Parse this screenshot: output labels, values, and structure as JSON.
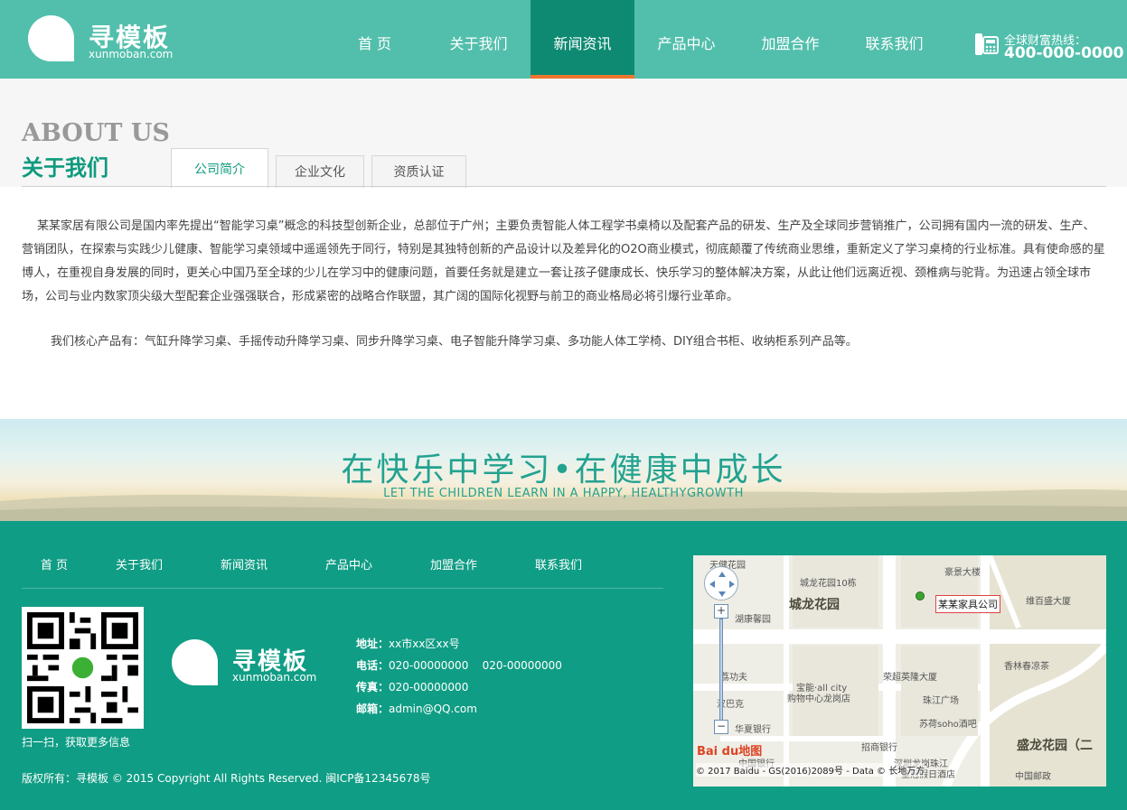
{
  "header": {
    "logo_cn": "寻模板",
    "logo_en": "xunmoban.com",
    "nav": [
      {
        "label": "首 页",
        "active": false
      },
      {
        "label": "关于我们",
        "active": false
      },
      {
        "label": "新闻资讯",
        "active": true
      },
      {
        "label": "产品中心",
        "active": false
      },
      {
        "label": "加盟合作",
        "active": false
      },
      {
        "label": "联系我们",
        "active": false
      }
    ],
    "hotline_label": "全球财富热线：",
    "hotline_number": "400-000-0000"
  },
  "about": {
    "title_en": "ABOUT US",
    "title_cn": "关于我们",
    "tabs": [
      {
        "label": "公司简介",
        "active": true
      },
      {
        "label": "企业文化",
        "active": false
      },
      {
        "label": "资质认证",
        "active": false
      }
    ],
    "paragraph1": "某某家居有限公司是国内率先提出“智能学习桌”概念的科技型创新企业，总部位于广州；主要负责智能人体工程学书桌椅以及配套产品的研发、生产及全球同步营销推广，公司拥有国内一流的研发、生产、营销团队，在探索与实践少儿健康、智能学习桌领域中遥遥领先于同行，特别是其独特创新的产品设计以及差异化的O2O商业模式，彻底颠覆了传统商业思维，重新定义了学习桌椅的行业标准。具有使命感的星博人，在重视自身发展的同时，更关心中国乃至全球的少儿在学习中的健康问题，首要任务就是建立一套让孩子健康成长、快乐学习的整体解决方案，从此让他们远离近视、颈椎病与驼背。为迅速占领全球市场，公司与业内数家顶尖级大型配套企业强强联合，形成紧密的战略合作联盟，其广阔的国际化视野与前卫的商业格局必将引爆行业革命。",
    "paragraph2": "我们核心产品有：气缸升降学习桌、手摇传动升降学习桌、同步升降学习桌、电子智能升降学习桌、多功能人体工学椅、DIY组合书柜、收纳柜系列产品等。"
  },
  "banner": {
    "slogan_cn": "在快乐中学习•在健康中成长",
    "slogan_en": "LET THE CHILDREN LEARN IN A HAPPY, HEALTHYGROWTH"
  },
  "footer": {
    "nav": [
      "首 页",
      "关于我们",
      "新闻资讯",
      "产品中心",
      "加盟合作",
      "联系我们"
    ],
    "qr_caption": "扫一扫，获取更多信息",
    "logo_cn": "寻模板",
    "logo_en": "xunmoban.com",
    "address_label": "地址：",
    "address": "xx市xx区xx号",
    "phone_label": "电话：",
    "phone": "020-00000000    020-00000000",
    "fax_label": "传真：",
    "fax": "020-00000000",
    "email_label": "邮箱：",
    "email": "admin@QQ.com",
    "copyright": "版权所有：寻模板 © 2015 Copyright  All Rights Reserved. 闽ICP备12345678号"
  },
  "map": {
    "marker": "某某家具公司",
    "labels": {
      "tianjian": "天健花园",
      "chenglong_10": "城龙花园10栋",
      "haoxin": "豪景大楼",
      "hukang": "湖康馨园",
      "weibai": "维百盛大厦",
      "jiuwu": "荔功夫",
      "baoneng": "宝能·all city",
      "baoneng2": "购物中心龙岗店",
      "rongchao": "荣超英隆大厦",
      "xiangsen": "香林春凉茶",
      "bake": "汉巴克",
      "zhujiang": "珠江广场",
      "huaxia": "华夏银行",
      "suhe": "苏荷soho酒吧",
      "zhaoshang": "招商银行",
      "zhongguo": "中国银行",
      "zhujiang2": "深圳龙岗珠江",
      "jiudian": "皇冠假日酒店",
      "youzheng": "中国邮政"
    },
    "big_labels": {
      "chenglong": "城龙花园",
      "shenglong": "盛龙花园（二"
    },
    "zoom_in": "+",
    "zoom_out": "−",
    "baidu": "Bai du地图",
    "copyright": "© 2017 Baidu - GS(2016)2089号 - Data © 长地万方"
  }
}
